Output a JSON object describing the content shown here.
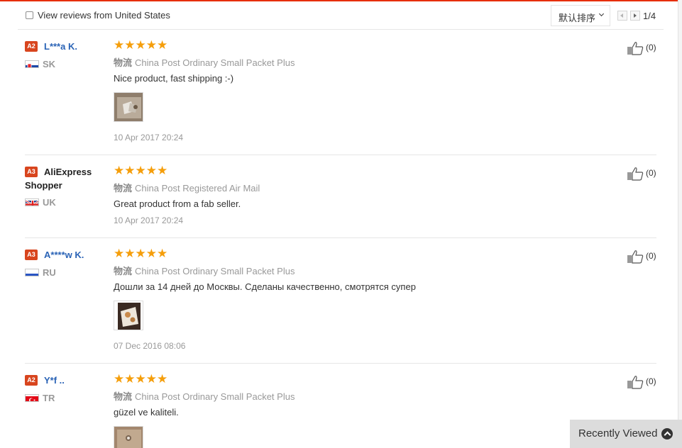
{
  "filter": {
    "checkbox_label": "View reviews from United States",
    "sort_label": "默认排序",
    "page_indicator": "1/4"
  },
  "reviews": [
    {
      "level": "A2",
      "name": "L***a K.",
      "country": "SK",
      "stars": "★★★★★",
      "shipping_prefix": "物流",
      "shipping": "China Post Ordinary Small Packet Plus",
      "text": "Nice product, fast shipping :-)",
      "date": "10 Apr 2017 20:24",
      "helpful": "(0)"
    },
    {
      "level": "A3",
      "name": "AliExpress Shopper",
      "country": "UK",
      "stars": "★★★★★",
      "shipping_prefix": "物流",
      "shipping": "China Post Registered Air Mail",
      "text": "Great product from a fab seller.",
      "date": "10 Apr 2017 20:24",
      "helpful": "(0)"
    },
    {
      "level": "A3",
      "name": "A****w K.",
      "country": "RU",
      "stars": "★★★★★",
      "shipping_prefix": "物流",
      "shipping": "China Post Ordinary Small Packet Plus",
      "text": "Дошли за 14 дней до Москвы. Сделаны качественно, смотрятся супер",
      "date": "07 Dec 2016 08:06",
      "helpful": "(0)"
    },
    {
      "level": "A2",
      "name": "Y*f ..",
      "country": "TR",
      "stars": "★★★★★",
      "shipping_prefix": "物流",
      "shipping": "China Post Ordinary Small Packet Plus",
      "text": "güzel ve kaliteli.",
      "helpful": "(0)"
    }
  ],
  "recently_viewed": "Recently Viewed",
  "colors": {
    "accent": "#e62e04",
    "star": "#f59e0b",
    "username": "#2a63b6",
    "level_badge": "#d8451e"
  }
}
